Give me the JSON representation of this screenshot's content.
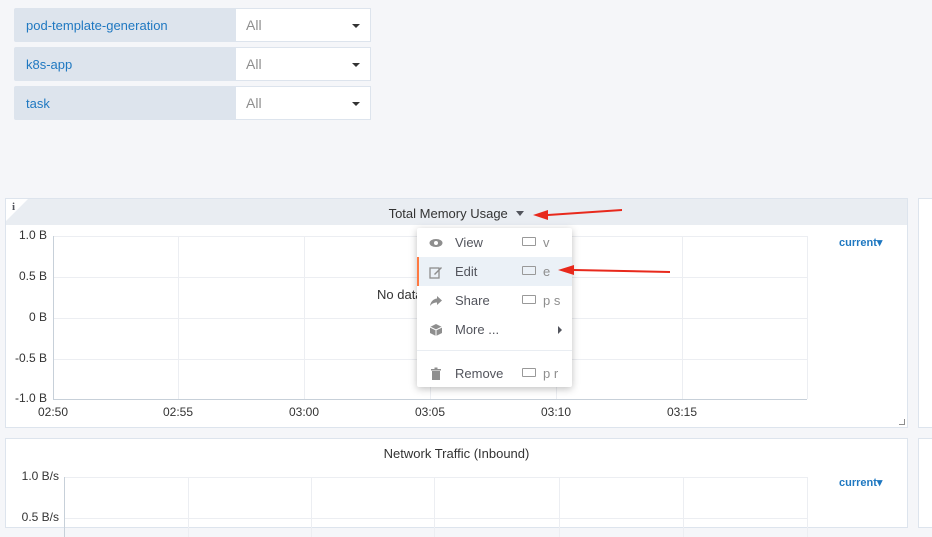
{
  "variables": [
    {
      "label": "pod-template-generation",
      "value": "All"
    },
    {
      "label": "k8s-app",
      "value": "All"
    },
    {
      "label": "task",
      "value": "All"
    }
  ],
  "panel1": {
    "title": "Total Memory Usage",
    "no_data": "No data",
    "legend": "current▾",
    "y_ticks": [
      "1.0 B",
      "0.5 B",
      "0 B",
      "-0.5 B",
      "-1.0 B"
    ],
    "x_ticks": [
      "02:50",
      "02:55",
      "03:00",
      "03:05",
      "03:10",
      "03:15"
    ],
    "info_icon": "i"
  },
  "menu": {
    "items": [
      {
        "label": "View",
        "shortcut": "v",
        "icon": "eye-icon"
      },
      {
        "label": "Edit",
        "shortcut": "e",
        "icon": "edit-icon"
      },
      {
        "label": "Share",
        "shortcut": "p s",
        "icon": "share-icon"
      },
      {
        "label": "More ...",
        "icon": "cube-icon"
      },
      {
        "label": "Remove",
        "shortcut": "p r",
        "icon": "trash-icon"
      }
    ]
  },
  "panel2": {
    "title": "Network Traffic (Inbound)",
    "legend": "current▾",
    "y_ticks": [
      "1.0 B/s",
      "0.5 B/s"
    ]
  },
  "colors": {
    "accent": "#1f78c1",
    "arrow": "#e8291c",
    "active_bar": "#ff7941"
  }
}
